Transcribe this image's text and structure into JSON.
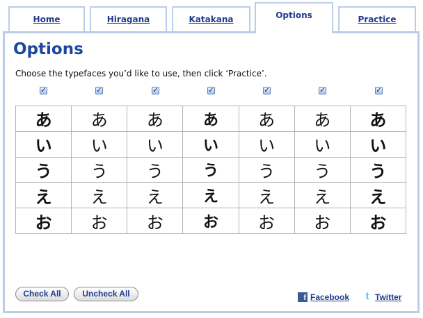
{
  "tabs": [
    {
      "label": "Home",
      "active": false
    },
    {
      "label": "Hiragana",
      "active": false
    },
    {
      "label": "Katakana",
      "active": false
    },
    {
      "label": "Options",
      "active": true
    },
    {
      "label": "Practice",
      "active": false
    }
  ],
  "page": {
    "title": "Options",
    "instructions": "Choose the typefaces you’d like to use, then click ‘Practice’."
  },
  "typefaces": {
    "checked": [
      true,
      true,
      true,
      true,
      true,
      true,
      true
    ]
  },
  "grid": {
    "rows": [
      [
        "あ",
        "あ",
        "あ",
        "あ",
        "あ",
        "あ",
        "あ"
      ],
      [
        "い",
        "い",
        "い",
        "い",
        "い",
        "い",
        "い"
      ],
      [
        "う",
        "う",
        "う",
        "う",
        "う",
        "う",
        "う"
      ],
      [
        "え",
        "え",
        "え",
        "え",
        "え",
        "え",
        "え"
      ],
      [
        "お",
        "お",
        "お",
        "お",
        "お",
        "お",
        "お"
      ]
    ]
  },
  "buttons": {
    "check_all": "Check All",
    "uncheck_all": "Uncheck All"
  },
  "social": {
    "facebook_label": "Facebook",
    "twitter_label": "Twitter",
    "facebook_icon": "facebook-icon",
    "twitter_icon": "twitter-icon"
  },
  "colors": {
    "accent": "#1a47a3",
    "link": "#1f3b8f",
    "border": "#bccbe6"
  }
}
